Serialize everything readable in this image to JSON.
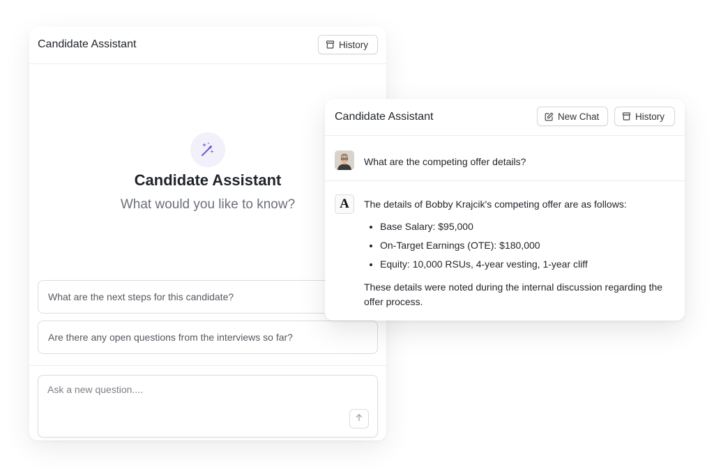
{
  "left_panel": {
    "title": "Candidate Assistant",
    "history_label": "History",
    "hero_title": "Candidate Assistant",
    "hero_subtitle": "What would you like to know?",
    "suggestions": [
      "What are the next steps for this candidate?",
      "Are there any open questions from the interviews so far?"
    ],
    "input_placeholder": "Ask a new question....",
    "input_value": ""
  },
  "right_panel": {
    "title": "Candidate Assistant",
    "new_chat_label": "New Chat",
    "history_label": "History",
    "question": "What are the competing offer details?",
    "answer_icon_letter": "A",
    "answer_intro": "The details of Bobby Krajcik's competing offer are as follows:",
    "answer_items": [
      "Base Salary: $95,000",
      "On-Target Earnings (OTE): $180,000",
      "Equity: 10,000 RSUs, 4-year vesting, 1-year cliff"
    ],
    "answer_outro": "These details were noted during the internal discussion regarding the offer process."
  },
  "icons": {
    "history": "archive-box-icon",
    "new_chat": "edit-square-icon",
    "hero": "magic-wand-sparkles-icon",
    "send": "arrow-up-icon",
    "avatar": "user-avatar"
  },
  "colors": {
    "accent": "#6c5fd3",
    "accent_bg": "#f1f0fb",
    "border": "#dcdcdc",
    "muted_text": "#6b6f76"
  }
}
